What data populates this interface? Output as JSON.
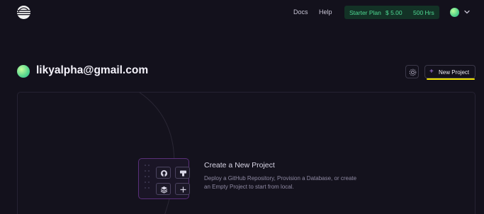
{
  "nav": {
    "docs_label": "Docs",
    "help_label": "Help",
    "plan": {
      "name": "Starter Plan",
      "credit": "$ 5.00",
      "hours": "500 Hrs"
    }
  },
  "profile": {
    "email": "likyalpha@gmail.com"
  },
  "actions": {
    "new_project_label": "New Project"
  },
  "empty_state": {
    "title": "Create a New Project",
    "description": "Deploy a GitHub Repository, Provision a Database, or create an Empty Project to start from local."
  },
  "icons": {
    "logo": "railway-logo-icon",
    "settings": "gear-icon",
    "add": "plus-icon",
    "menu": "chevron-down-icon",
    "github": "github-icon",
    "template": "template-icon",
    "database": "database-icon",
    "empty": "plus-icon"
  },
  "colors": {
    "background": "#13111c",
    "plan_bg": "#133226",
    "plan_text": "#4fd893",
    "accent": "#b987ff",
    "highlight": "#f3e600"
  }
}
